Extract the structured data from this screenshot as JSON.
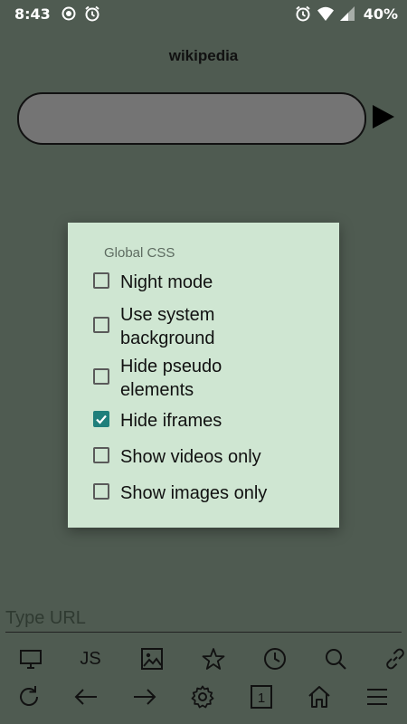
{
  "status_bar": {
    "time": "8:43",
    "battery": "40%"
  },
  "page": {
    "title": "wikipedia"
  },
  "dialog": {
    "title": "Global CSS",
    "options": [
      {
        "label": "Night mode",
        "checked": false
      },
      {
        "label": "Use system background",
        "checked": false
      },
      {
        "label": "Hide pseudo elements",
        "checked": false
      },
      {
        "label": "Hide iframes",
        "checked": true
      },
      {
        "label": "Show videos only",
        "checked": false
      },
      {
        "label": "Show images only",
        "checked": false
      }
    ]
  },
  "url_bar": {
    "placeholder": "Type URL"
  },
  "toolbar": {
    "js_label": "JS",
    "tabs_count": "1"
  },
  "colors": {
    "background": "#4f5b51",
    "dialog_background": "#cfe6d2",
    "checkbox_checked": "#1f7f7b",
    "url_pill": "#747474"
  },
  "icons": {
    "toolbar_top": [
      "desktop-icon",
      "js-icon",
      "image-icon",
      "star-icon",
      "history-clock-icon",
      "search-icon",
      "link-icon"
    ],
    "toolbar_bottom": [
      "reload-icon",
      "back-arrow-icon",
      "forward-arrow-icon",
      "settings-gear-icon",
      "tabs-count-icon",
      "home-icon",
      "menu-icon"
    ]
  }
}
